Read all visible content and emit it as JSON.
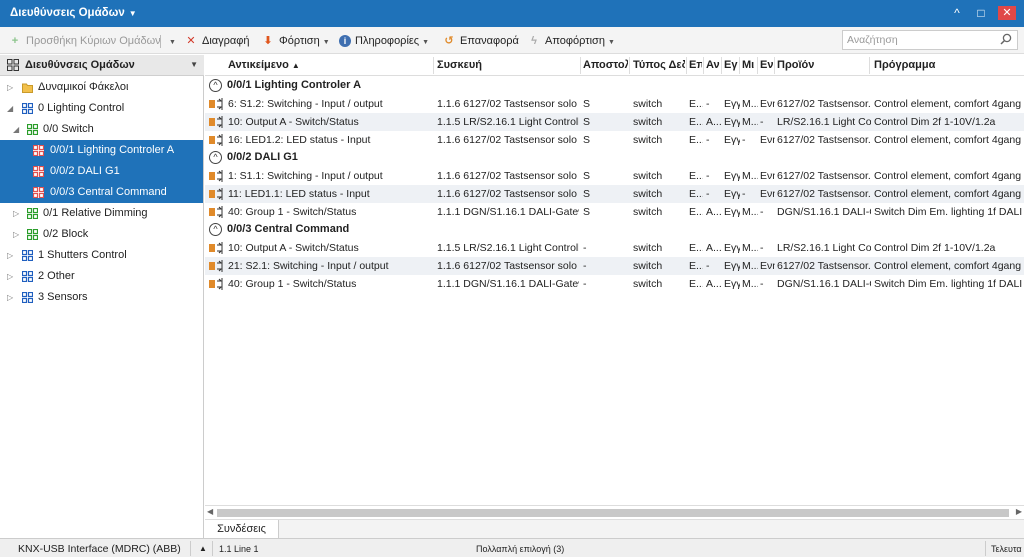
{
  "window": {
    "title": "Διευθύνσεις Ομάδων",
    "minimize": "^",
    "restore": "□",
    "close": "✕"
  },
  "toolbar": {
    "add_main_group": "Προσθήκη Κύριων Ομάδων",
    "delete": "Διαγραφή",
    "download": "Φόρτιση",
    "info": "Πληροφορίες",
    "reset": "Επαναφορά",
    "unload": "Αποφόρτιση",
    "search_placeholder": "Αναζήτηση"
  },
  "tree": {
    "header": "Διευθύνσεις Ομάδων",
    "items": [
      {
        "label": "Δυναμικοί Φάκελοι"
      },
      {
        "label": "0 Lighting Control"
      },
      {
        "label": "0/0 Switch"
      },
      {
        "label": "0/0/1 Lighting Controler A"
      },
      {
        "label": "0/0/2 DALI G1"
      },
      {
        "label": "0/0/3 Central Command"
      },
      {
        "label": "0/1 Relative Dimming"
      },
      {
        "label": "0/2 Block"
      },
      {
        "label": "1 Shutters Control"
      },
      {
        "label": "2 Other"
      },
      {
        "label": "3 Sensors"
      }
    ]
  },
  "table": {
    "columns": [
      "Αντικείμενο",
      "Συσκευή",
      "Αποστολ",
      "Τύπος Δεδ",
      "Επ",
      "Αν",
      "Εγ",
      "Μι",
      "Εν",
      "Προϊόν",
      "Πρόγραμμα"
    ],
    "groups": [
      {
        "label": "0/0/1 Lighting Controler A",
        "rows": [
          [
            "6: S1.2: Switching - Input / output",
            "1.1.6 6127/02 Tastsensor solo K...",
            "S",
            "switch",
            "E...",
            "-",
            "Εγγ",
            "M...",
            "Ενη",
            "6127/02 Tastsensor...",
            "Control element, comfort 4gang,"
          ],
          [
            "10: Output A - Switch/Status",
            "1.1.5 LR/S2.16.1 Light Controller...",
            "S",
            "switch",
            "E...",
            "A...",
            "Εγγ",
            "M...",
            "-",
            "LR/S2.16.1 Light Co...",
            "Control Dim 2f 1-10V/1.2a"
          ],
          [
            "16: LED1.2: LED status - Input",
            "1.1.6 6127/02 Tastsensor solo K...",
            "S",
            "switch",
            "E...",
            "-",
            "Εγγ",
            "-",
            "Ενη",
            "6127/02 Tastsensor...",
            "Control element, comfort 4gang,"
          ]
        ]
      },
      {
        "label": "0/0/2 DALI G1",
        "rows": [
          [
            "1: S1.1: Switching - Input / output",
            "1.1.6 6127/02 Tastsensor solo K...",
            "S",
            "switch",
            "E...",
            "-",
            "Εγγ",
            "M...",
            "Ενη",
            "6127/02 Tastsensor...",
            "Control element, comfort 4gang,"
          ],
          [
            "11: LED1.1: LED status - Input",
            "1.1.6 6127/02 Tastsensor solo K...",
            "S",
            "switch",
            "E...",
            "-",
            "Εγγ",
            "-",
            "Ενη",
            "6127/02 Tastsensor...",
            "Control element, comfort 4gang,"
          ],
          [
            "40: Group 1 - Switch/Status",
            "1.1.1 DGN/S1.16.1 DALI-Gatewa...",
            "S",
            "switch",
            "E...",
            "A...",
            "Εγγ",
            "M...",
            "-",
            "DGN/S1.16.1 DALI-G...",
            "Switch Dim Em. lighting 1f DALI/1."
          ]
        ]
      },
      {
        "label": "0/0/3 Central Command",
        "rows": [
          [
            "10: Output A - Switch/Status",
            "1.1.5 LR/S2.16.1 Light Controller...",
            "-",
            "switch",
            "E...",
            "A...",
            "Εγγ",
            "M...",
            "-",
            "LR/S2.16.1 Light Co...",
            "Control Dim 2f 1-10V/1.2a"
          ],
          [
            "21: S2.1: Switching - Input / output",
            "1.1.6 6127/02 Tastsensor solo K...",
            "-",
            "switch",
            "E...",
            "-",
            "Εγγ",
            "M...",
            "Ενη",
            "6127/02 Tastsensor...",
            "Control element, comfort 4gang,"
          ],
          [
            "40: Group 1 - Switch/Status",
            "1.1.1 DGN/S1.16.1 DALI-Gatewa...",
            "-",
            "switch",
            "E...",
            "A...",
            "Εγγ",
            "M...",
            "-",
            "DGN/S1.16.1 DALI-G...",
            "Switch Dim Em. lighting 1f DALI/1."
          ]
        ]
      }
    ]
  },
  "bottom_tab": "Συνδέσεις",
  "status": {
    "interface": "KNX-USB Interface (MDRC) (ABB)",
    "line": "1.1 Line 1",
    "selection": "Πολλαπλή επιλογή (3)",
    "right": "Τελευτα"
  },
  "colors": {
    "accent": "#1f72b9",
    "group_green": "#2a9d2a",
    "main_blue": "#1f5fbf",
    "selected_red": "#e05050"
  }
}
